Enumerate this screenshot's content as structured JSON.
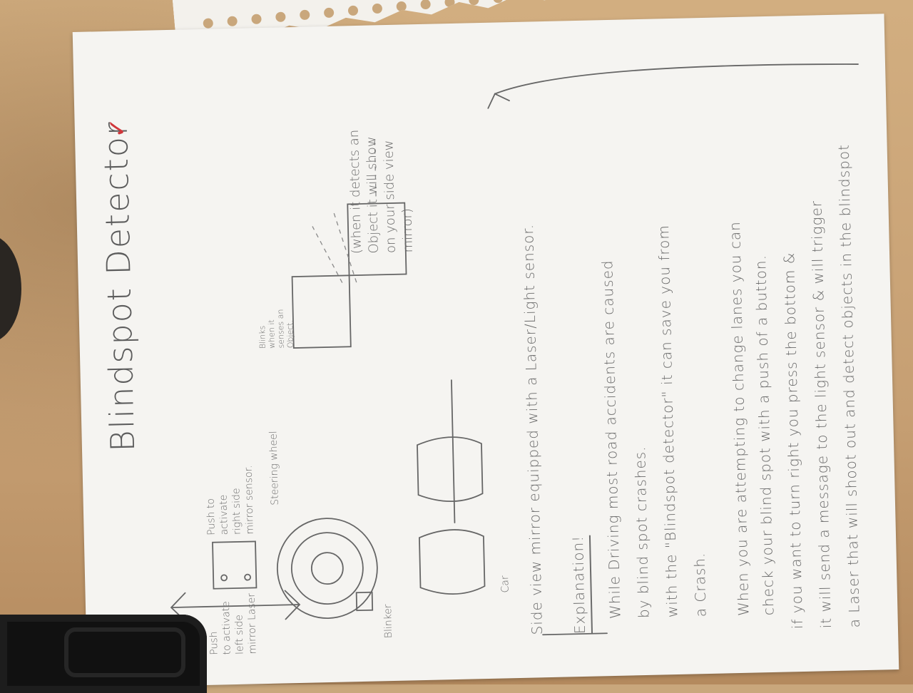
{
  "title": "Blindspot Detector",
  "labels": {
    "left_laser": "Push\nto activate\nleft side\nmirror Laser",
    "right_sensor": "Push to\nactivate\nright side\nmirror sensor.",
    "steering": "Steering wheel",
    "blinker": "Blinker",
    "blinks": "Blinks\nwhen it\nsenses an\nObject.",
    "detects": "(when it detects an\nObject it will show\non your side view\nmirror)",
    "car_mark": "Car"
  },
  "caption": "Side view mirror equipped with a Laser/Light sensor.",
  "explanation": {
    "heading": "Explanation!",
    "lines": [
      "While Driving most road accidents are caused",
      "by blind spot crashes.",
      "with the \"Blindspot detector\" it can save you from",
      "a Crash.",
      "When you are attempting to change lanes you can",
      "check your blind spot with a push of a button.",
      "if you want to turn right you press the bottom &",
      "it will send a message to the light sensor & will trigger",
      "a Laser that will shoot out and detect objects in the blindspot"
    ]
  },
  "colors": {
    "pencil": "#6b6b6b",
    "checkmark": "#d0363a",
    "paper": "#f5f4f1"
  }
}
